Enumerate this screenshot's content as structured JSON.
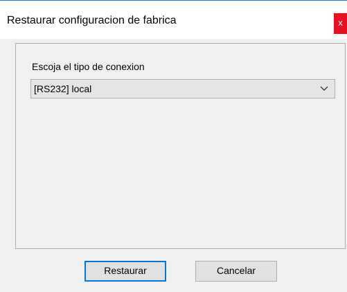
{
  "window": {
    "title": "Restaurar configuracion de fabrica",
    "close_label": "x"
  },
  "connection": {
    "label": "Escoja el tipo de conexion",
    "selected": "[RS232] local"
  },
  "buttons": {
    "restore_label": "Restaurar",
    "cancel_label": "Cancelar"
  },
  "colors": {
    "close_button": "#e81123",
    "accent_border": "#0078d7",
    "title_border": "#1883d7"
  },
  "icons": {
    "dropdown": "chevron-down-icon"
  }
}
